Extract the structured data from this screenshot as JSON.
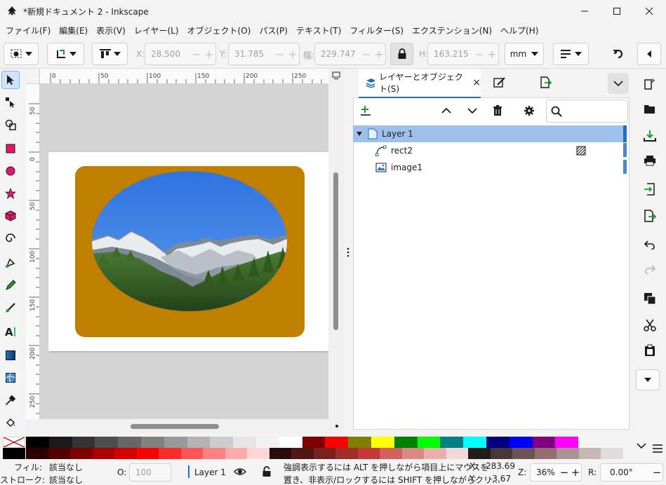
{
  "window": {
    "title": "*新規ドキュメント 2 - Inkscape"
  },
  "menu": [
    "ファイル(F)",
    "編集(E)",
    "表示(V)",
    "レイヤー(L)",
    "オブジェクト(O)",
    "パス(P)",
    "テキスト(T)",
    "フィルター(S)",
    "エクステンション(N)",
    "ヘルプ(H)"
  ],
  "toolbar": {
    "x_label": "X:",
    "x_value": "28.500",
    "y_label": "Y:",
    "y_value": "31.785",
    "w_label": "幅:",
    "w_value": "229.747",
    "h_label": "H:",
    "h_value": "163.215",
    "unit": "mm"
  },
  "ruler": {
    "top_ticks": [
      "0",
      "50",
      "100",
      "150",
      "200",
      "250"
    ],
    "left_ticks": [
      "50",
      "0",
      "50",
      "100",
      "150",
      "200",
      "250"
    ]
  },
  "panel": {
    "tab_label": "レイヤーとオブジェクト(S)",
    "tab_close": "×",
    "layer_name": "Layer 1",
    "objects": [
      "rect2",
      "image1"
    ]
  },
  "status": {
    "fill_label": "フィル:",
    "fill_value": "該当なし",
    "stroke_label": "ストローク:",
    "stroke_value": "該当なし",
    "opacity_label": "O:",
    "opacity_value": "100",
    "layer": "Layer 1",
    "message_line1": "強調表示するには ALT を押しながら項目上にマウスを",
    "message_line2": "置き、非表示/ロックするには SHIFT を押しながらクリ…",
    "x_label": "X:",
    "x_value": "283.69",
    "y_label": "Y:",
    "y_value": "-3.67",
    "zoom_label": "Z:",
    "zoom_value": "36%",
    "rotate_label": "R:",
    "rotate_value": "0.00°"
  },
  "colors": {
    "accent": "#1e6fc6",
    "selection": "#9ec1ec",
    "shape_fill": "#c17f00",
    "sky": "#3a82e6"
  },
  "palette": {
    "row1": [
      "#000000",
      "#1a1a1a",
      "#333333",
      "#4d4d4d",
      "#666666",
      "#808080",
      "#999999",
      "#b3b3b3",
      "#cccccc",
      "#e6e6e6",
      "#f2f2f2",
      "#ffffff",
      "#800000",
      "#ff0000",
      "#808000",
      "#ffff00",
      "#008000",
      "#00ff00",
      "#008080",
      "#00ffff",
      "#000080",
      "#0000ff",
      "#800080",
      "#ff00ff"
    ],
    "row2": [
      "#2b0000",
      "#550000",
      "#800000",
      "#aa0000",
      "#d40000",
      "#ff0000",
      "#ff2a2a",
      "#ff5555",
      "#ff8080",
      "#ffaaaa",
      "#ffd5d5",
      "#280b0b",
      "#501616",
      "#782121",
      "#a02c2c",
      "#c83737",
      "#d35f5f",
      "#de8787",
      "#e9afaf",
      "#f4d7d7",
      "#241c1c",
      "#483737",
      "#6c5353",
      "#916f6f",
      "#ac9393",
      "#c8b7b7",
      "#e3dbdb"
    ]
  }
}
